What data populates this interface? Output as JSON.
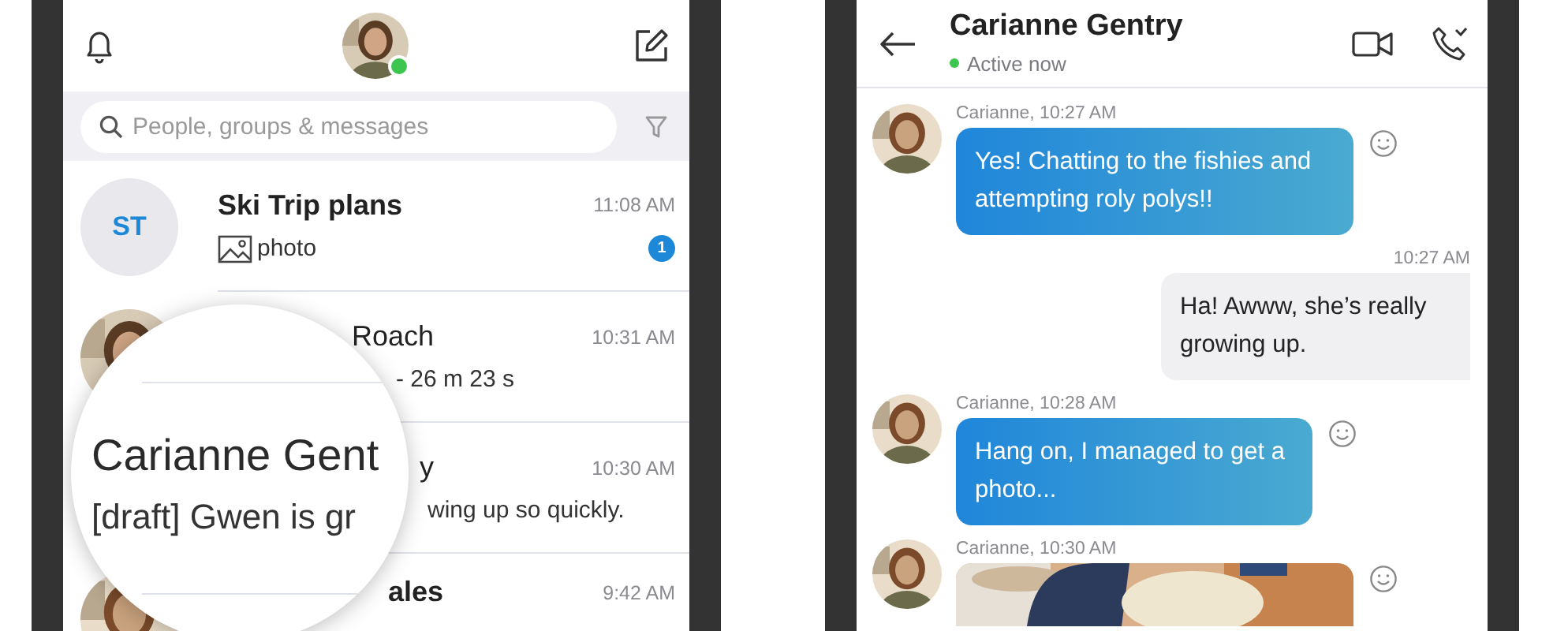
{
  "conversation_list": {
    "profile": {
      "online": true
    },
    "search": {
      "placeholder": "People, groups & messages"
    },
    "chats": [
      {
        "kind": "group",
        "initials": "ST",
        "name": "Ski Trip plans",
        "time": "11:08 AM",
        "preview": "photo",
        "image_attachment": true,
        "unread": "1"
      },
      {
        "kind": "person",
        "name": "Roach",
        "time": "10:31 AM",
        "preview": "- 26 m 23 s"
      },
      {
        "kind": "covered",
        "name": "y",
        "time": "10:30 AM",
        "preview": "wing up so quickly."
      },
      {
        "kind": "person",
        "name": "ales",
        "time": "9:42 AM"
      }
    ],
    "magnifier": {
      "name": "Carianne Gent",
      "preview": "[draft] Gwen is gr"
    }
  },
  "conversation": {
    "title": "Carianne Gentry",
    "online": true,
    "presence": "Active now",
    "messages": [
      {
        "kind": "incoming",
        "meta": "Carianne, 10:27 AM",
        "text": "Yes! Chatting to the fishies and attempting roly polys!!"
      },
      {
        "kind": "outgoing",
        "meta": "10:27 AM",
        "text": "Ha! Awww, she’s really growing up."
      },
      {
        "kind": "incoming",
        "meta": "Carianne, 10:28 AM",
        "text": "Hang on, I managed to get a photo..."
      },
      {
        "meta": "Carianne, 10:30 AM"
      }
    ]
  }
}
